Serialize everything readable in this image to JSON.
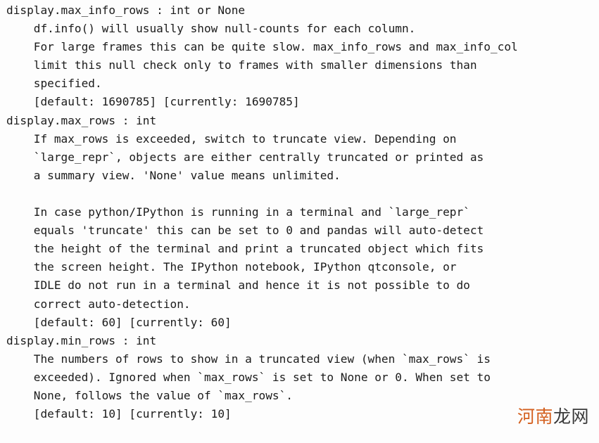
{
  "terminal": {
    "background_color": "#fdfdfd",
    "text_color": "#1b1b1b",
    "lines": [
      "display.max_info_rows : int or None",
      "    df.info() will usually show null-counts for each column.",
      "    For large frames this can be quite slow. max_info_rows and max_info_col",
      "    limit this null check only to frames with smaller dimensions than",
      "    specified.",
      "    [default: 1690785] [currently: 1690785]",
      "display.max_rows : int",
      "    If max_rows is exceeded, switch to truncate view. Depending on",
      "    `large_repr`, objects are either centrally truncated or printed as",
      "    a summary view. 'None' value means unlimited.",
      "",
      "    In case python/IPython is running in a terminal and `large_repr`",
      "    equals 'truncate' this can be set to 0 and pandas will auto-detect",
      "    the height of the terminal and print a truncated object which fits",
      "    the screen height. The IPython notebook, IPython qtconsole, or",
      "    IDLE do not run in a terminal and hence it is not possible to do",
      "    correct auto-detection.",
      "    [default: 60] [currently: 60]",
      "display.min_rows : int",
      "    The numbers of rows to show in a truncated view (when `max_rows` is",
      "    exceeded). Ignored when `max_rows` is set to None or 0. When set to",
      "    None, follows the value of `max_rows`.",
      "    [default: 10] [currently: 10]"
    ],
    "options": [
      {
        "name": "display.max_info_rows",
        "type": "int or None",
        "default": "1690785",
        "currently": "1690785"
      },
      {
        "name": "display.max_rows",
        "type": "int",
        "default": "60",
        "currently": "60"
      },
      {
        "name": "display.min_rows",
        "type": "int",
        "default": "10",
        "currently": "10"
      }
    ]
  },
  "watermark": {
    "text_accent": "河南",
    "text_dark": "龙网",
    "accent_color": "#d4601f",
    "dark_color": "#3a3a3a"
  }
}
